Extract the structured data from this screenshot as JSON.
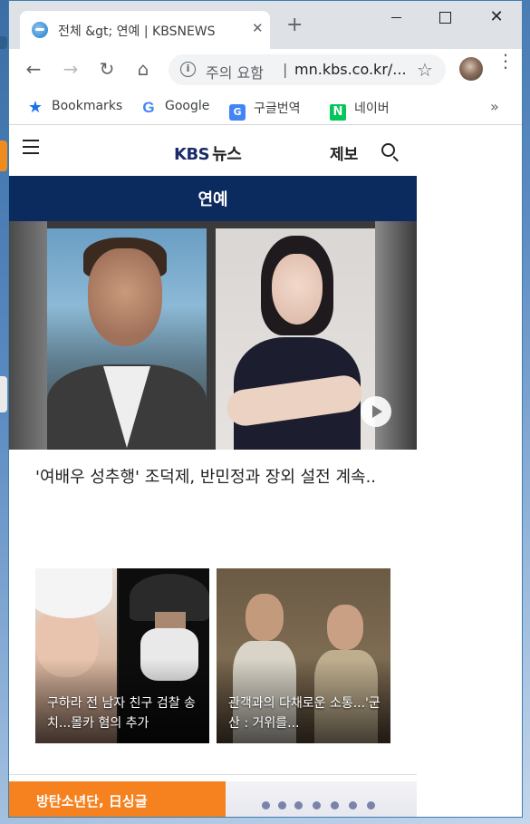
{
  "browser": {
    "tab_title": "전체 &gt; 연예 | KBSNEWS",
    "tab_close_glyph": "✕",
    "new_tab_glyph": "+",
    "window_close_glyph": "✕",
    "nav": {
      "back": "←",
      "forward": "→",
      "reload": "↻",
      "home": "⌂"
    },
    "omnibox": {
      "info_glyph": "i",
      "warning": "주의 요함",
      "separator": "|",
      "url": "mn.kbs.co.kr/...",
      "star_glyph": "☆"
    },
    "menu_glyph": "⋮",
    "bookmarks": [
      {
        "label": "Bookmarks",
        "icon": "star-icon",
        "glyph": "★"
      },
      {
        "label": "Google",
        "icon": "google-icon",
        "glyph": "G"
      },
      {
        "label": "구글번역",
        "icon": "translate-icon",
        "glyph": "G"
      },
      {
        "label": "네이버",
        "icon": "naver-icon",
        "glyph": "N"
      }
    ],
    "bookmarks_more": "»"
  },
  "site": {
    "logo_kbs": "KBS",
    "logo_news": "뉴스",
    "report_label": "제보",
    "section_title": "연예",
    "hero_headline": "'여배우 성추행' 조덕제, 반민정과 장외 설전 계속..",
    "articles": [
      {
        "caption": "구하라 전 남자 친구 검찰 송치...몰카 혐의 추가"
      },
      {
        "caption": "관객과의 다채로운 소통...'군산 : 거위를..."
      }
    ],
    "tag_label": "방탄소년단, 日싱글"
  },
  "colors": {
    "brand_navy": "#0b2a5e",
    "tag_orange": "#f5821f",
    "chrome_frame": "#dee1e6"
  }
}
